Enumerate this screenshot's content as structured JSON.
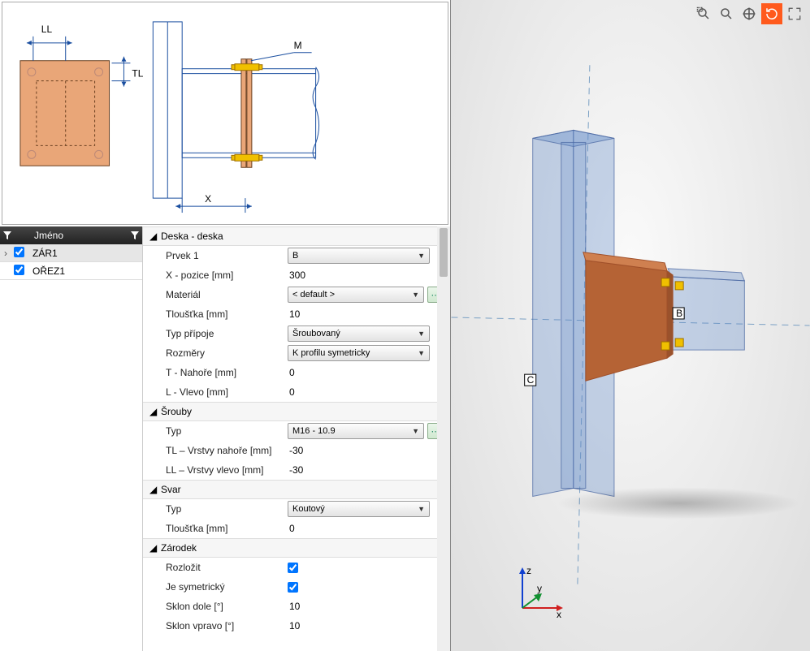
{
  "grid": {
    "header_name": "Jméno",
    "rows": [
      {
        "name": "ZÁR1",
        "checked": true,
        "expand": true
      },
      {
        "name": "OŘEZ1",
        "checked": true,
        "expand": false
      }
    ]
  },
  "diagram_labels": {
    "LL": "LL",
    "TL": "TL",
    "M": "M",
    "X": "X"
  },
  "sections": {
    "deska": {
      "title": "Deska - deska",
      "prvek1_label": "Prvek 1",
      "prvek1_value": "B",
      "xpozice_label": "X - pozice [mm]",
      "xpozice_value": "300",
      "material_label": "Materiál",
      "material_value": "< default >",
      "tloustka_label": "Tloušťka [mm]",
      "tloustka_value": "10",
      "typpripoje_label": "Typ přípoje",
      "typpripoje_value": "Šroubovaný",
      "rozmery_label": "Rozměry",
      "rozmery_value": "K profilu symetricky",
      "tnahore_label": "T - Nahoře [mm]",
      "tnahore_value": "0",
      "lvlevo_label": "L - Vlevo [mm]",
      "lvlevo_value": "0"
    },
    "srouby": {
      "title": "Šrouby",
      "typ_label": "Typ",
      "typ_value": "M16 - 10.9",
      "tl_label": "TL – Vrstvy nahoře [mm]",
      "tl_value": "-30",
      "ll_label": "LL – Vrstvy vlevo [mm]",
      "ll_value": "-30"
    },
    "svar": {
      "title": "Svar",
      "typ_label": "Typ",
      "typ_value": "Koutový",
      "tloustka_label": "Tloušťka [mm]",
      "tloustka_value": "0"
    },
    "zarodek": {
      "title": "Zárodek",
      "rozlozit_label": "Rozložit",
      "rozlozit_value": true,
      "jesym_label": "Je symetrický",
      "jesym_value": true,
      "sklondole_label": "Sklon dole [°]",
      "sklondole_value": "10",
      "sklonvpravo_label": "Sklon vpravo [°]",
      "sklonvpravo_value": "10"
    }
  },
  "viewport": {
    "label_B": "B",
    "label_C": "C",
    "axes": {
      "x": "x",
      "y": "y",
      "z": "z"
    }
  }
}
